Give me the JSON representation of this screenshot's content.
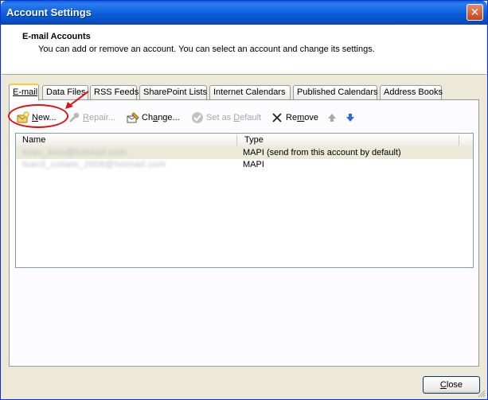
{
  "window": {
    "title": "Account Settings",
    "close_glyph": "✕"
  },
  "header": {
    "title": "E-mail Accounts",
    "description": "You can add or remove an account. You can select an account and change its settings."
  },
  "tabs": [
    {
      "label": "E-mail",
      "active": true
    },
    {
      "label": "Data Files"
    },
    {
      "label": "RSS Feeds"
    },
    {
      "label": "SharePoint Lists"
    },
    {
      "label": "Internet Calendars"
    },
    {
      "label": "Published Calendars"
    },
    {
      "label": "Address Books"
    }
  ],
  "toolbar": {
    "new": {
      "prefix": "",
      "mnemonic": "N",
      "suffix": "ew...",
      "icon": "new-account-icon"
    },
    "repair": {
      "prefix": "",
      "mnemonic": "R",
      "suffix": "epair...",
      "icon": "repair-icon",
      "disabled": true
    },
    "change": {
      "prefix": "Ch",
      "mnemonic": "a",
      "suffix": "nge...",
      "icon": "change-icon"
    },
    "set_default": {
      "prefix": "Set as ",
      "mnemonic": "D",
      "suffix": "efault",
      "icon": "check-circle-icon",
      "disabled": true
    },
    "remove": {
      "prefix": "Re",
      "mnemonic": "m",
      "suffix": "ove",
      "icon": "x-icon"
    },
    "move_up": {
      "icon": "arrow-up-icon",
      "disabled": true
    },
    "move_down": {
      "icon": "arrow-down-icon"
    }
  },
  "accounts": {
    "columns": [
      "Name",
      "Type"
    ],
    "rows": [
      {
        "name": "tsiau_kinu@hotmail.com",
        "type": "MAPI (send from this account by default)",
        "selected": true
      },
      {
        "name": "tsan3_coliam_2008@hotmail.com",
        "type": "MAPI"
      }
    ]
  },
  "footer": {
    "close_prefix": "",
    "close_mnemonic": "C",
    "close_suffix": "lose"
  },
  "colors": {
    "annotation": "#e01010",
    "title_bar": "#0a5fd8",
    "dialog_bg": "#ece9d8"
  }
}
